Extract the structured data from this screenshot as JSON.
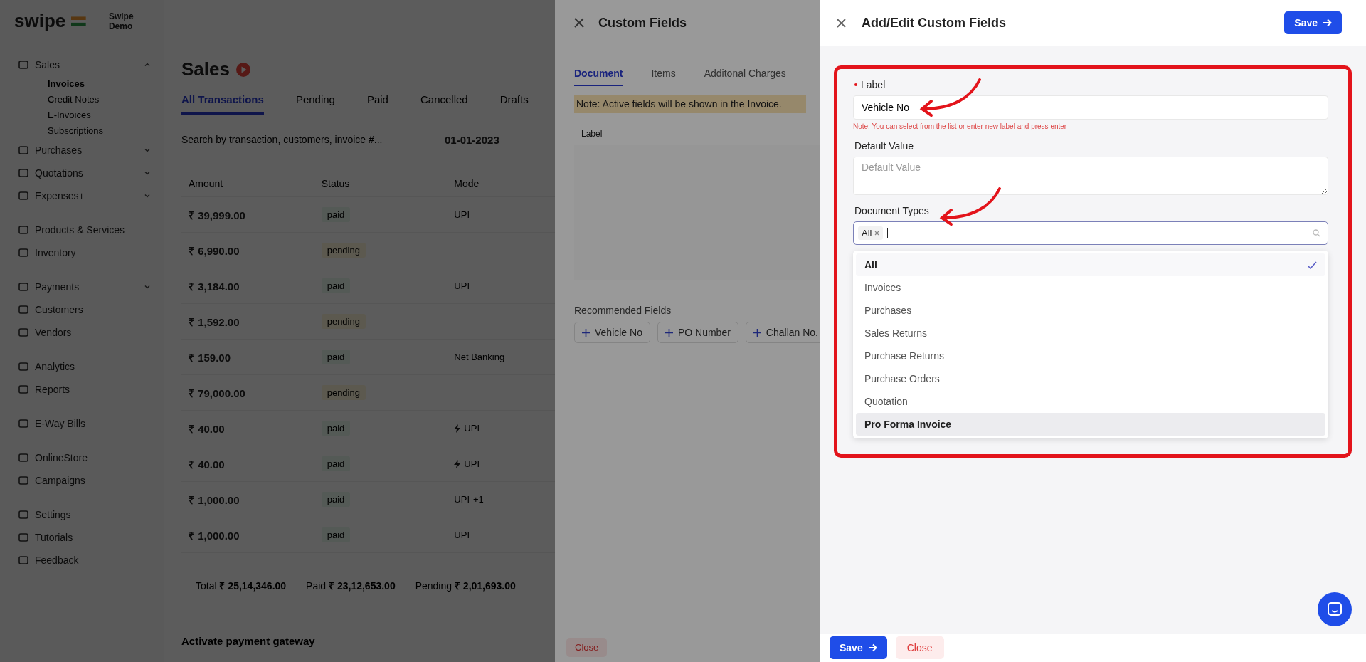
{
  "app": {
    "brand": "swipe",
    "company": "Swipe Demo",
    "sidebar": {
      "groups": [
        {
          "items": [
            {
              "label": "Sales",
              "expanded": true,
              "children": [
                {
                  "label": "Invoices",
                  "selected": true
                },
                {
                  "label": "Credit Notes",
                  "selected": false
                },
                {
                  "label": "E-Invoices",
                  "selected": false
                },
                {
                  "label": "Subscriptions",
                  "selected": false
                }
              ]
            },
            {
              "label": "Purchases",
              "expanded": false
            },
            {
              "label": "Quotations",
              "expanded": false
            },
            {
              "label": "Expenses+",
              "expanded": false
            }
          ]
        },
        {
          "items": [
            {
              "label": "Products & Services"
            },
            {
              "label": "Inventory"
            }
          ]
        },
        {
          "items": [
            {
              "label": "Payments",
              "expanded": false
            },
            {
              "label": "Customers"
            },
            {
              "label": "Vendors"
            }
          ]
        },
        {
          "items": [
            {
              "label": "Analytics"
            },
            {
              "label": "Reports"
            }
          ]
        },
        {
          "items": [
            {
              "label": "E-Way Bills"
            }
          ]
        },
        {
          "items": [
            {
              "label": "OnlineStore"
            },
            {
              "label": "Campaigns"
            }
          ]
        },
        {
          "items": [
            {
              "label": "Settings"
            },
            {
              "label": "Tutorials"
            },
            {
              "label": "Feedback"
            }
          ]
        }
      ]
    },
    "main": {
      "title": "Sales",
      "tabs": [
        {
          "label": "All Transactions",
          "selected": true
        },
        {
          "label": "Pending",
          "selected": false
        },
        {
          "label": "Paid",
          "selected": false
        },
        {
          "label": "Cancelled",
          "selected": false
        },
        {
          "label": "Drafts",
          "selected": false
        }
      ],
      "search": {
        "placeholder": "Search by transaction, customers, invoice #..."
      },
      "date": "01-01-2023",
      "table": {
        "columns": [
          "Amount",
          "Status",
          "Mode"
        ],
        "rows": [
          {
            "amount": "₹ 39,999.00",
            "status": "paid",
            "kind": "paid",
            "mode": "UPI"
          },
          {
            "amount": "₹ 6,990.00",
            "status": "pending",
            "kind": "pending"
          },
          {
            "amount": "₹ 3,184.00",
            "status": "paid",
            "kind": "paid",
            "mode": "UPI"
          },
          {
            "amount": "₹ 1,592.00",
            "status": "pending",
            "kind": "pending"
          },
          {
            "amount": "₹ 159.00",
            "status": "paid",
            "kind": "paid",
            "mode": "Net Banking"
          },
          {
            "amount": "₹ 79,000.00",
            "status": "pending",
            "kind": "pending"
          },
          {
            "amount": "₹ 40.00",
            "status": "paid",
            "kind": "paid",
            "mode": "UPI",
            "instant": true
          },
          {
            "amount": "₹ 40.00",
            "status": "paid",
            "kind": "paid",
            "mode": "UPI",
            "instant": true
          },
          {
            "amount": "₹ 1,000.00",
            "status": "paid",
            "kind": "paid",
            "mode": "UPI",
            "mode_extra": "+1"
          },
          {
            "amount": "₹ 1,000.00",
            "status": "paid",
            "kind": "paid",
            "mode": "UPI"
          }
        ]
      },
      "totals": [
        {
          "label": "Total",
          "value": "₹ 25,14,346.00"
        },
        {
          "label": "Paid",
          "value": "₹ 23,12,653.00"
        },
        {
          "label": "Pending",
          "value": "₹ 2,01,693.00"
        }
      ],
      "promo": {
        "title": "Activate payment gateway"
      }
    }
  },
  "custom_fields": {
    "title": "Custom Fields",
    "tabs": [
      {
        "label": "Document",
        "selected": true
      },
      {
        "label": "Items",
        "selected": false
      },
      {
        "label": "Additonal Charges",
        "selected": false
      }
    ],
    "note": "Note: Active fields will be shown in the Invoice.",
    "table": {
      "columns": [
        "Label"
      ]
    },
    "recommended": {
      "title": "Recommended Fields",
      "chips": [
        "Vehicle No",
        "PO Number",
        "Challan No."
      ]
    },
    "footer": {
      "close": "Close"
    }
  },
  "editor": {
    "title": "Add/Edit Custom Fields",
    "save": "Save",
    "label": {
      "title": "Label",
      "required": true,
      "value": "Vehicle No",
      "note": "Note: You can select from the list or enter new label and press enter"
    },
    "default_value": {
      "title": "Default Value",
      "placeholder": "Default Value"
    },
    "document_types": {
      "title": "Document Types",
      "tags": [
        "All"
      ],
      "options": [
        {
          "label": "All",
          "selected": true,
          "active": false
        },
        {
          "label": "Invoices",
          "selected": false,
          "active": false
        },
        {
          "label": "Purchases",
          "selected": false,
          "active": false
        },
        {
          "label": "Sales Returns",
          "selected": false,
          "active": false
        },
        {
          "label": "Purchase Returns",
          "selected": false,
          "active": false
        },
        {
          "label": "Purchase Orders",
          "selected": false,
          "active": false
        },
        {
          "label": "Quotation",
          "selected": false,
          "active": false
        },
        {
          "label": "Pro Forma Invoice",
          "selected": false,
          "active": true
        }
      ]
    },
    "footer": {
      "save": "Save",
      "close": "Close"
    }
  }
}
